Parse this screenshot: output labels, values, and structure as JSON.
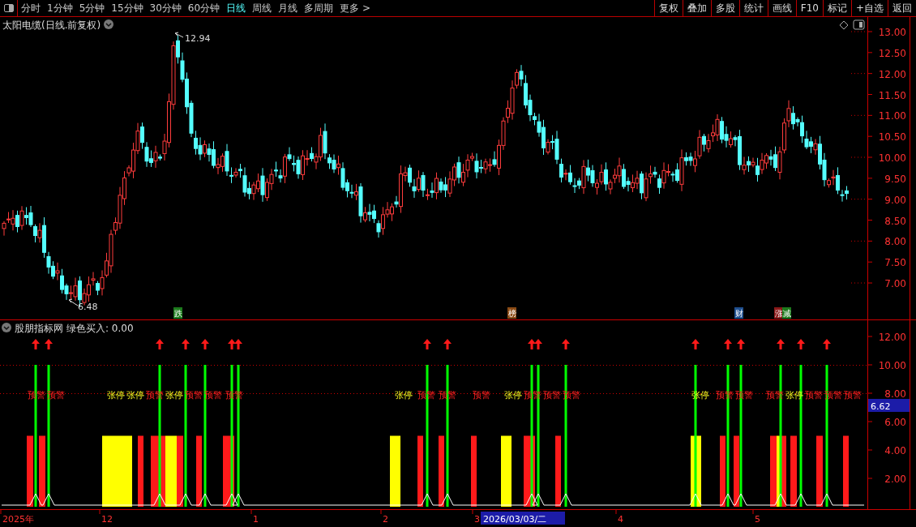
{
  "toolbar": {
    "periods": [
      {
        "label": "分时",
        "selected": false
      },
      {
        "label": "1分钟",
        "selected": false
      },
      {
        "label": "5分钟",
        "selected": false
      },
      {
        "label": "15分钟",
        "selected": false
      },
      {
        "label": "30分钟",
        "selected": false
      },
      {
        "label": "60分钟",
        "selected": false
      },
      {
        "label": "日线",
        "selected": true
      },
      {
        "label": "周线",
        "selected": false
      },
      {
        "label": "月线",
        "selected": false
      },
      {
        "label": "多周期",
        "selected": false
      },
      {
        "label": "更多 >",
        "selected": false
      }
    ],
    "actions": [
      "复权",
      "叠加",
      "多股",
      "统计",
      "画线",
      "F10",
      "标记",
      "+自选",
      "返回"
    ]
  },
  "price_panel": {
    "title": "太阳电缆(日线.前复权)",
    "y_axis": [
      "13.00",
      "12.50",
      "12.00",
      "11.50",
      "11.00",
      "10.50",
      "10.00",
      "9.50",
      "9.00",
      "8.50",
      "8.00",
      "7.50",
      "7.00"
    ],
    "high_label": "12.94",
    "low_label": "6.48",
    "events": [
      {
        "text": "跌",
        "color": "#1c7a1c"
      },
      {
        "text": "榜",
        "color": "#8a4a14"
      },
      {
        "text": "财",
        "color": "#1f4f8f"
      },
      {
        "text": "涨",
        "color": "#8a1818"
      },
      {
        "text": "减",
        "color": "#1c7a1c"
      }
    ]
  },
  "indicator_panel": {
    "title": "股朋指标网",
    "reading": "绿色买入: 0.00",
    "y_axis": [
      "12.00",
      "10.00",
      "8.00",
      "6.00",
      "4.00",
      "2.00"
    ],
    "current_value": "6.62",
    "signals": [
      {
        "kind": "alert",
        "text": "预警"
      },
      {
        "kind": "alert",
        "text": "预警"
      },
      {
        "kind": "limit_up",
        "text": "张停"
      },
      {
        "kind": "limit_up",
        "text": "张停"
      },
      {
        "kind": "alert",
        "text": "预警"
      },
      {
        "kind": "limit_up",
        "text": "张停"
      },
      {
        "kind": "alert",
        "text": "预警"
      },
      {
        "kind": "alert",
        "text": "预警"
      },
      {
        "kind": "alert",
        "text": "预警"
      },
      {
        "kind": "limit_up",
        "text": "张停"
      },
      {
        "kind": "alert",
        "text": "预警"
      },
      {
        "kind": "alert",
        "text": "预警"
      },
      {
        "kind": "alert",
        "text": "预警"
      },
      {
        "kind": "limit_up",
        "text": "张停"
      },
      {
        "kind": "alert",
        "text": "预警"
      },
      {
        "kind": "alert",
        "text": "预警"
      },
      {
        "kind": "alert",
        "text": "预警"
      },
      {
        "kind": "limit_up",
        "text": "张停"
      },
      {
        "kind": "alert",
        "text": "预警"
      },
      {
        "kind": "alert",
        "text": "预警"
      },
      {
        "kind": "alert",
        "text": "预警"
      },
      {
        "kind": "limit_up",
        "text": "张停"
      },
      {
        "kind": "alert",
        "text": "预警"
      },
      {
        "kind": "alert",
        "text": "预警"
      },
      {
        "kind": "alert",
        "text": "预警"
      }
    ]
  },
  "date_axis": {
    "labels": [
      "2025年",
      "12",
      "1",
      "2",
      "3",
      "4",
      "5"
    ],
    "cursor_date": "2026/03/03/二"
  }
}
